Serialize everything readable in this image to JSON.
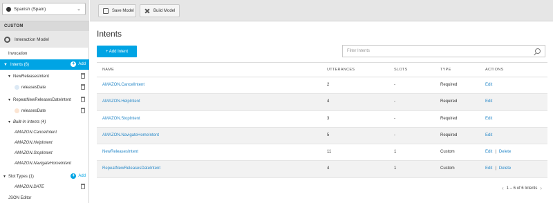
{
  "sidebar": {
    "language": "Spanish (Spain)",
    "section_header": "CUSTOM",
    "interaction_model": "Interaction Model",
    "items": [
      {
        "label": "Invocation"
      },
      {
        "label": "Intents (6)",
        "add_label": "Add"
      },
      {
        "label": "NewReleasesIntent"
      },
      {
        "label": "releasesDate"
      },
      {
        "label": "RepeatNewReleasesDateIntent"
      },
      {
        "label": "releasesDate"
      },
      {
        "label": "Built-In Intents (4)"
      },
      {
        "label": "AMAZON.CancelIntent"
      },
      {
        "label": "AMAZON.HelpIntent"
      },
      {
        "label": "AMAZON.StopIntent"
      },
      {
        "label": "AMAZON.NavigateHomeIntent"
      },
      {
        "label": "Slot Types (1)",
        "add_label": "Add"
      },
      {
        "label": "AMAZON.DATE"
      },
      {
        "label": "JSON Editor"
      }
    ]
  },
  "toolbar": {
    "save_label": "Save Model",
    "build_label": "Build Model"
  },
  "main": {
    "title": "Intents",
    "add_button": "+ Add Intent",
    "filter_placeholder": "Filter Intents",
    "columns": [
      "NAME",
      "UTTERANCES",
      "SLOTS",
      "TYPE",
      "ACTIONS"
    ],
    "rows": [
      {
        "name": "AMAZON.CancelIntent",
        "utterances": "2",
        "slots": "-",
        "type": "Required",
        "edit": "Edit",
        "delete": ""
      },
      {
        "name": "AMAZON.HelpIntent",
        "utterances": "4",
        "slots": "-",
        "type": "Required",
        "edit": "Edit",
        "delete": ""
      },
      {
        "name": "AMAZON.StopIntent",
        "utterances": "3",
        "slots": "-",
        "type": "Required",
        "edit": "Edit",
        "delete": ""
      },
      {
        "name": "AMAZON.NavigateHomeIntent",
        "utterances": "5",
        "slots": "-",
        "type": "Required",
        "edit": "Edit",
        "delete": ""
      },
      {
        "name": "NewReleasesIntent",
        "utterances": "11",
        "slots": "1",
        "type": "Custom",
        "edit": "Edit",
        "delete": "Delete"
      },
      {
        "name": "RepeatNewReleasesDateIntent",
        "utterances": "4",
        "slots": "1",
        "type": "Custom",
        "edit": "Edit",
        "delete": "Delete"
      }
    ],
    "pagination": "1 – 6 of 6 Intents"
  },
  "colors": {
    "accent": "#00a4e4",
    "link": "#2a8ac9"
  }
}
